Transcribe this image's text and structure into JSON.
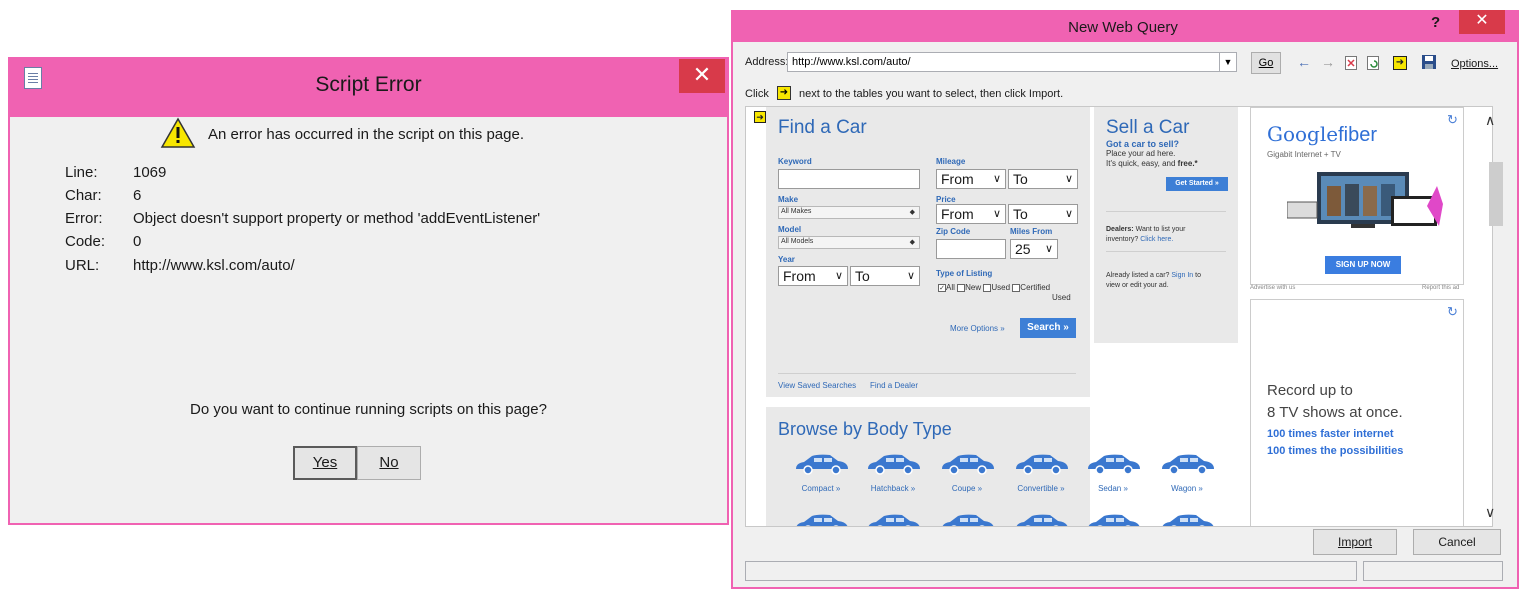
{
  "script_error": {
    "title": "Script Error",
    "close_glyph": "✕",
    "message": "An error has occurred in the script on this page.",
    "fields": [
      {
        "key": "Line:",
        "value": "1069"
      },
      {
        "key": "Char:",
        "value": "6"
      },
      {
        "key": "Error:",
        "value": "Object doesn't support property or method 'addEventListener'"
      },
      {
        "key": "Code:",
        "value": "0"
      },
      {
        "key": "URL:",
        "value": "http://www.ksl.com/auto/"
      }
    ],
    "question": "Do you want to continue running scripts on this page?",
    "yes_label": "Yes",
    "no_label": "No"
  },
  "web_query": {
    "title": "New Web Query",
    "help_glyph": "?",
    "close_glyph": "✕",
    "address_label": "Address:",
    "address_value": "http://www.ksl.com/auto/",
    "go_label": "Go",
    "options_label": "Options...",
    "click_label": "Click",
    "click_hint": "next to the tables you want to select, then click Import.",
    "import_label": "Import",
    "cancel_label": "Cancel",
    "toolbar_icons": [
      "back-arrow-icon",
      "forward-arrow-icon",
      "stop-icon",
      "refresh-icon",
      "select-tables-icon",
      "save-query-icon"
    ]
  },
  "page": {
    "find_car": {
      "title": "Find a Car",
      "keyword_label": "Keyword",
      "mileage_label": "Mileage",
      "mileage_from": "From",
      "mileage_to": "To",
      "make_label": "Make",
      "make_value": "All Makes",
      "price_label": "Price",
      "price_from": "From",
      "price_to": "To",
      "model_label": "Model",
      "model_value": "All Models",
      "zip_label": "Zip Code",
      "miles_from_label": "Miles From",
      "miles_from_value": "25",
      "year_label": "Year",
      "year_from": "From",
      "year_to": "To",
      "listing_label": "Type of Listing",
      "listing_all": "All",
      "listing_new": "New",
      "listing_used": "Used",
      "listing_certified": "Certified",
      "listing_certified2": "Used",
      "more_options": "More Options »",
      "search_label": "Search »",
      "saved_searches": "View Saved Searches",
      "find_dealer": "Find a Dealer"
    },
    "sell_car": {
      "title": "Sell a Car",
      "subtitle": "Got a car to sell?",
      "line1": "Place your ad here.",
      "line2a": "It's quick, easy, and",
      "line2b": "free.*",
      "get_started": "Get Started »",
      "dealers_bold": "Dealers:",
      "dealers_text": "Want to list your",
      "dealers_text2": "inventory?",
      "click_here": "Click here.",
      "listed_text": "Already listed a car?",
      "sign_in": "Sign In",
      "listed_text2": "to",
      "listed_text3": "view or edit your ad."
    },
    "browse": {
      "title": "Browse by Body Type",
      "types": [
        "Compact »",
        "Hatchback »",
        "Coupe »",
        "Convertible »",
        "Sedan »",
        "Wagon »"
      ]
    },
    "ad1": {
      "brand": "Google",
      "product": "fiber",
      "tagline": "Gigabit Internet + TV",
      "cta": "SIGN UP NOW",
      "advertise": "Advertise with us",
      "report": "Report this ad"
    },
    "ad2": {
      "line1": "Record up to",
      "line2": "8 TV shows at once.",
      "line3": "100 times faster internet",
      "line4": "100 times the possibilities"
    }
  },
  "colors": {
    "titlebar": "#f062b2",
    "close": "#d83a4a",
    "link_blue": "#2f69b7",
    "marker_yellow": "#f7e600"
  }
}
